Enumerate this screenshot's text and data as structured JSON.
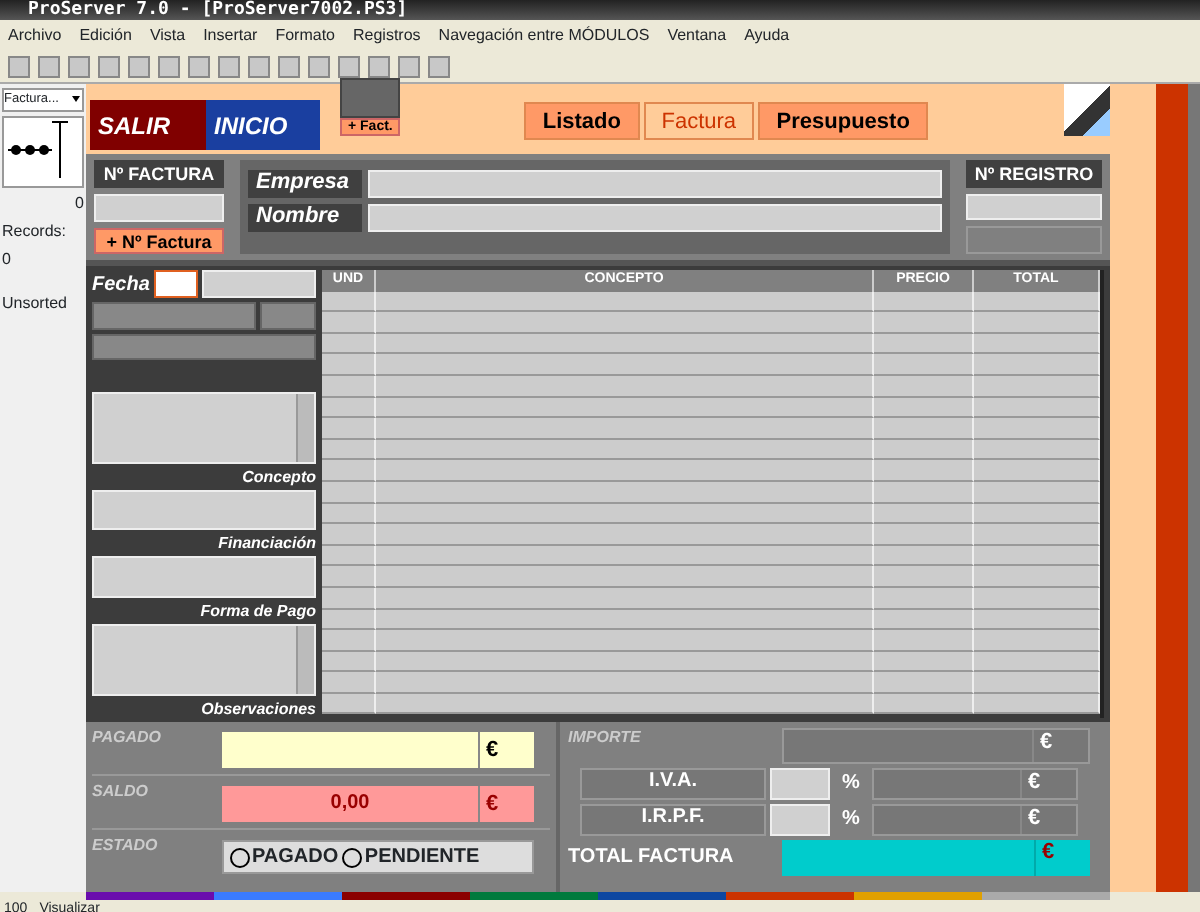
{
  "window": {
    "title": "ProServer 7.0 - [ProServer7002.PS3]"
  },
  "menu": [
    "Archivo",
    "Edición",
    "Vista",
    "Insertar",
    "Formato",
    "Registros",
    "Navegación entre MÓDULOS",
    "Ventana",
    "Ayuda"
  ],
  "sidebar": {
    "dropdown": "Factura...",
    "slider_max": "0",
    "records_label": "Records:",
    "records": "0",
    "sort": "Unsorted"
  },
  "header": {
    "exit": "SALIR",
    "home": "INICIO",
    "new_invoice": "+ Fact.",
    "tabs": [
      {
        "label": "Listado",
        "selected": false
      },
      {
        "label": "Factura",
        "selected": true
      },
      {
        "label": "Presupuesto",
        "selected": false
      }
    ]
  },
  "invoice_number": {
    "label": "Nº FACTURA",
    "button": "+ Nº Factura"
  },
  "client_fields": [
    {
      "label": "Empresa"
    },
    {
      "label": "Nombre"
    }
  ],
  "registry": {
    "label": "Nº REGISTRO"
  },
  "date_label": "Fecha",
  "side_fields": [
    {
      "label": "Concepto",
      "kind": "scroll"
    },
    {
      "label": "Financiación",
      "kind": "plain"
    },
    {
      "label": "Forma de Pago",
      "kind": "plain"
    },
    {
      "label": "Observaciones",
      "kind": "scroll"
    }
  ],
  "table": {
    "columns": [
      "UND",
      "CONCEPTO",
      "PRECIO",
      "TOTAL"
    ]
  },
  "payment": {
    "paid_label": "PAGADO",
    "paid_currency": "€",
    "balance_label": "SALDO",
    "balance": "0,00",
    "balance_currency": "€",
    "status_label": "ESTADO",
    "status_options": [
      {
        "label": "PAGADO",
        "selected": false
      },
      {
        "label": "PENDIENTE",
        "selected": false
      }
    ]
  },
  "totals": {
    "amount_label": "IMPORTE",
    "amount_currency": "€",
    "taxes": [
      {
        "label": "I.V.A.",
        "percent": "%",
        "currency": "€"
      },
      {
        "label": "I.R.P.F.",
        "percent": "%",
        "currency": "€"
      }
    ],
    "total_label": "TOTAL FACTURA",
    "total_currency": "€"
  },
  "status_bar": {
    "zoom": "100",
    "mode": "Visualizar"
  }
}
